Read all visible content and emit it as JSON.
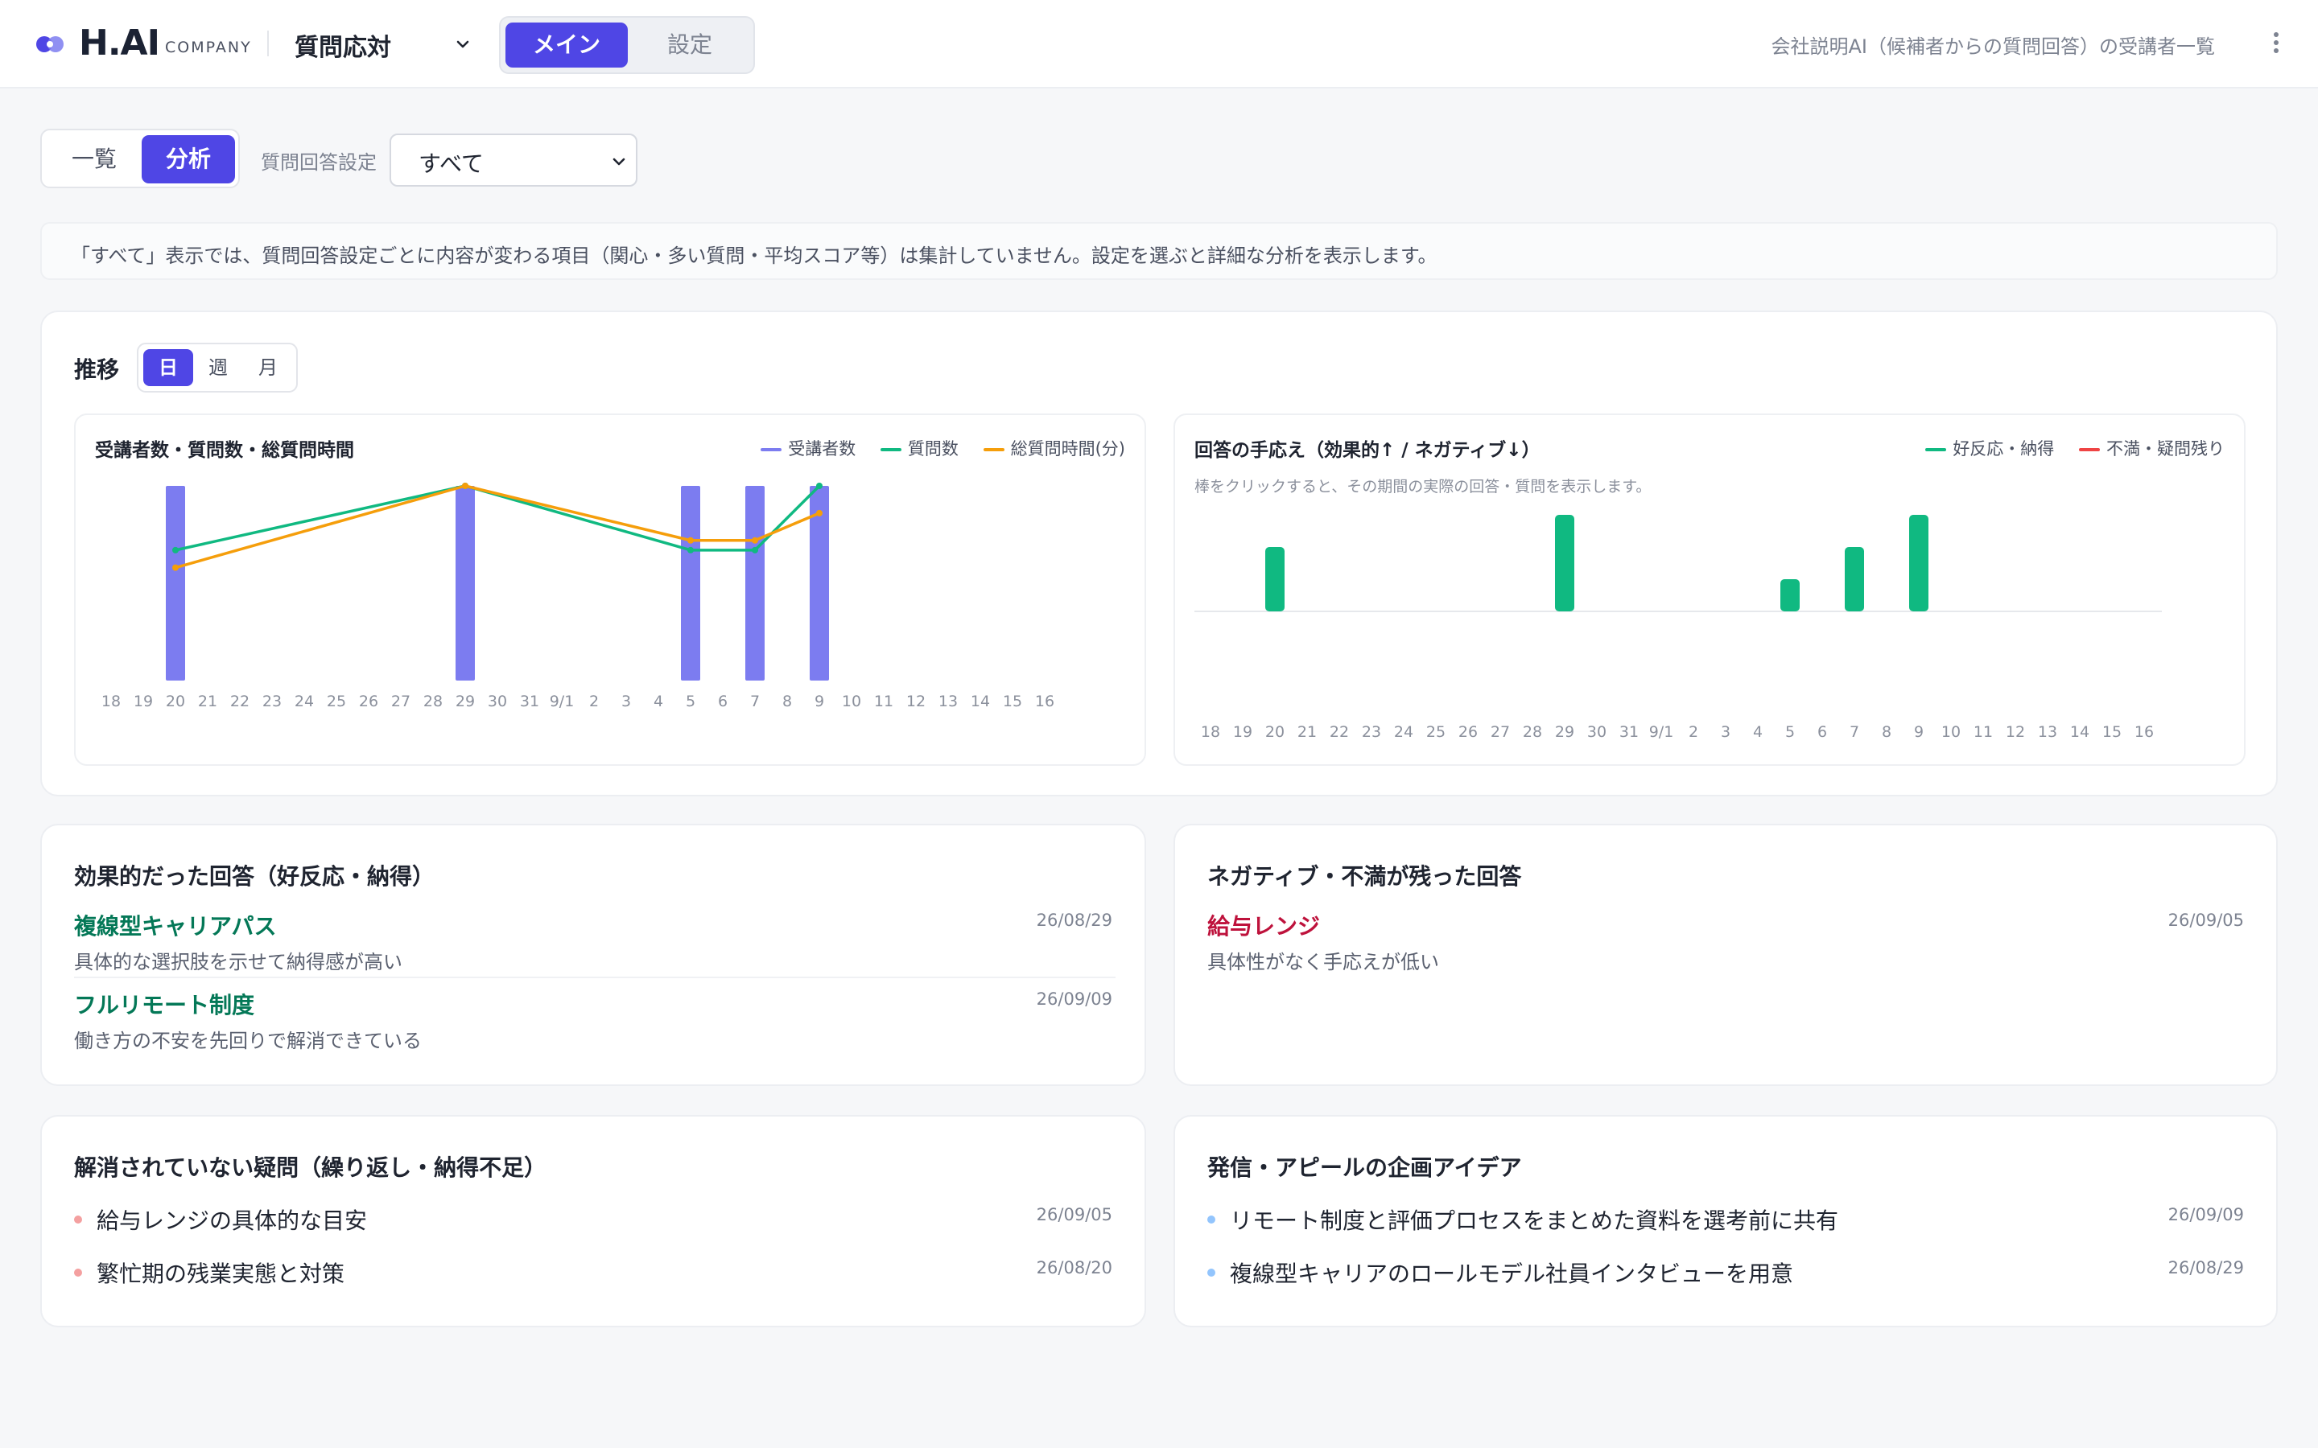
{
  "header": {
    "logo": "H.AI",
    "logo_sub": "COMPANY",
    "feature_select": "質問応対",
    "mode_main": "メイン",
    "mode_settings": "設定",
    "breadcrumb_right": "会社説明AI（候補者からの質問回答）の受講者一覧"
  },
  "toolbar": {
    "tab_list": "一覧",
    "tab_analysis": "分析",
    "qa_setting_label": "質問回答設定",
    "qa_setting_value": "すべて"
  },
  "notice": "「すべて」表示では、質問回答設定ごとに内容が変わる項目（関心・多い質問・平均スコア等）は集計していません。設定を選ぶと詳細な分析を表示します。",
  "trend": {
    "title": "推移",
    "period_day": "日",
    "period_week": "週",
    "period_month": "月"
  },
  "colors": {
    "accent": "#4f46e5",
    "bar_participants": "#7c7cf0",
    "line_questions": "#10b981",
    "line_time": "#f59e0b",
    "positive": "#10b981",
    "negative": "#ef4444",
    "positive_text": "#047857",
    "negative_text": "#be123c"
  },
  "chart_data": [
    {
      "type": "bar",
      "title": "受講者数・質問数・総質問時間",
      "categories": [
        "18",
        "19",
        "20",
        "21",
        "22",
        "23",
        "24",
        "25",
        "26",
        "27",
        "28",
        "29",
        "30",
        "31",
        "9/1",
        "2",
        "3",
        "4",
        "5",
        "6",
        "7",
        "8",
        "9",
        "10",
        "11",
        "12",
        "13",
        "14",
        "15",
        "16"
      ],
      "series": [
        {
          "name": "受講者数",
          "kind": "bar",
          "values": [
            0,
            0,
            1,
            0,
            0,
            0,
            0,
            0,
            0,
            0,
            0,
            1,
            0,
            0,
            0,
            0,
            0,
            0,
            1,
            0,
            1,
            0,
            1,
            0,
            0,
            0,
            0,
            0,
            0,
            0
          ]
        },
        {
          "name": "質問数",
          "kind": "line",
          "points": [
            [
              2,
              0.67
            ],
            [
              11,
              1.0
            ],
            [
              18,
              0.67
            ],
            [
              20,
              0.67
            ],
            [
              22,
              1.0
            ]
          ]
        },
        {
          "name": "総質問時間(分)",
          "kind": "line",
          "points": [
            [
              2,
              0.58
            ],
            [
              11,
              1.0
            ],
            [
              18,
              0.72
            ],
            [
              20,
              0.72
            ],
            [
              22,
              0.86
            ]
          ]
        }
      ],
      "ylim": [
        0,
        1
      ]
    },
    {
      "type": "bar",
      "title": "回答の手応え（効果的↑ / ネガティブ↓）",
      "hint": "棒をクリックすると、その期間の実際の回答・質問を表示します。",
      "categories": [
        "18",
        "19",
        "20",
        "21",
        "22",
        "23",
        "24",
        "25",
        "26",
        "27",
        "28",
        "29",
        "30",
        "31",
        "9/1",
        "2",
        "3",
        "4",
        "5",
        "6",
        "7",
        "8",
        "9",
        "10",
        "11",
        "12",
        "13",
        "14",
        "15",
        "16"
      ],
      "series": [
        {
          "name": "好反応・納得",
          "values": [
            0,
            0,
            2,
            0,
            0,
            0,
            0,
            0,
            0,
            0,
            0,
            3,
            0,
            0,
            0,
            0,
            0,
            0,
            1,
            0,
            2,
            0,
            3,
            0,
            0,
            0,
            0,
            0,
            0,
            0
          ]
        },
        {
          "name": "不満・疑問残り",
          "values": [
            0,
            0,
            0,
            0,
            0,
            0,
            0,
            0,
            0,
            0,
            0,
            0,
            0,
            0,
            0,
            0,
            0,
            0,
            0,
            0,
            0,
            0,
            0,
            0,
            0,
            0,
            0,
            0,
            0,
            0
          ]
        }
      ],
      "ylim": [
        -3,
        3
      ]
    }
  ],
  "effective": {
    "title": "効果的だった回答（好反応・納得）",
    "items": [
      {
        "title": "複線型キャリアパス",
        "desc": "具体的な選択肢を示せて納得感が高い",
        "date": "26/08/29"
      },
      {
        "title": "フルリモート制度",
        "desc": "働き方の不安を先回りで解消できている",
        "date": "26/09/09"
      }
    ]
  },
  "negative": {
    "title": "ネガティブ・不満が残った回答",
    "items": [
      {
        "title": "給与レンジ",
        "desc": "具体性がなく手応えが低い",
        "date": "26/09/05"
      }
    ]
  },
  "unresolved": {
    "title": "解消されていない疑問（繰り返し・納得不足）",
    "items": [
      {
        "text": "給与レンジの具体的な目安",
        "date": "26/09/05"
      },
      {
        "text": "繁忙期の残業実態と対策",
        "date": "26/08/20"
      }
    ]
  },
  "ideas": {
    "title": "発信・アピールの企画アイデア",
    "items": [
      {
        "text": "リモート制度と評価プロセスをまとめた資料を選考前に共有",
        "date": "26/09/09"
      },
      {
        "text": "複線型キャリアのロールモデル社員インタビューを用意",
        "date": "26/08/29"
      }
    ]
  }
}
